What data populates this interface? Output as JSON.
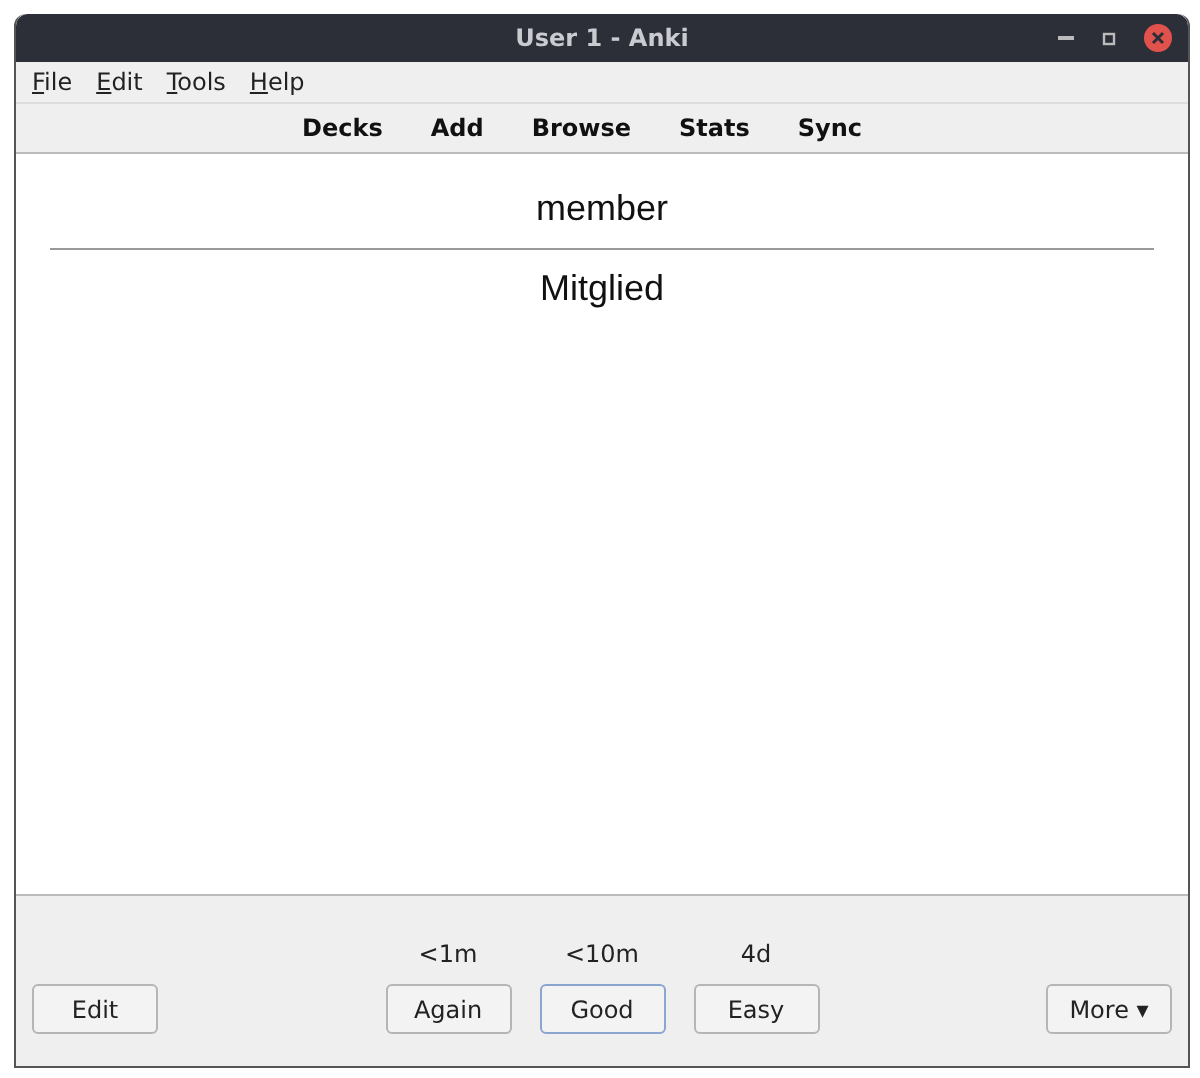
{
  "window": {
    "title": "User 1 - Anki"
  },
  "menu": [
    "File",
    "Edit",
    "Tools",
    "Help"
  ],
  "toolbar": [
    "Decks",
    "Add",
    "Browse",
    "Stats",
    "Sync"
  ],
  "card": {
    "front": "member",
    "back": "Mitglied"
  },
  "bottom": {
    "edit_button": "Edit",
    "answers": [
      {
        "interval": "<1m",
        "label": "Again",
        "focused": false
      },
      {
        "interval": "<10m",
        "label": "Good",
        "focused": true
      },
      {
        "interval": "4d",
        "label": "Easy",
        "focused": false
      }
    ],
    "more_button": "More ▾"
  }
}
